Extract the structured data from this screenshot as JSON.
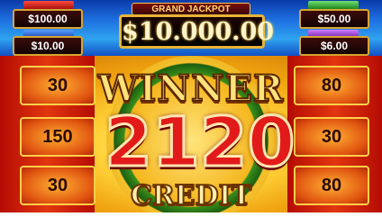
{
  "jackpots": {
    "grand": {
      "label": "GRAND JACKPOT",
      "value": "$10.000.00"
    },
    "left_top": {
      "value": "$100.00"
    },
    "left_bottom": {
      "value": "$10.00"
    },
    "right_top": {
      "value": "$50.00"
    },
    "right_bottom": {
      "value": "$6.00"
    }
  },
  "reels": {
    "left": [
      "30",
      "150",
      "30"
    ],
    "right": [
      "80",
      "30",
      "80"
    ]
  },
  "win": {
    "title": "WINNER",
    "amount": "2120",
    "unit": "CREDIT"
  },
  "colors": {
    "accent_gold": "#e8b337",
    "win_red": "#e21a1a",
    "top_blue": "#1e6fe0"
  }
}
